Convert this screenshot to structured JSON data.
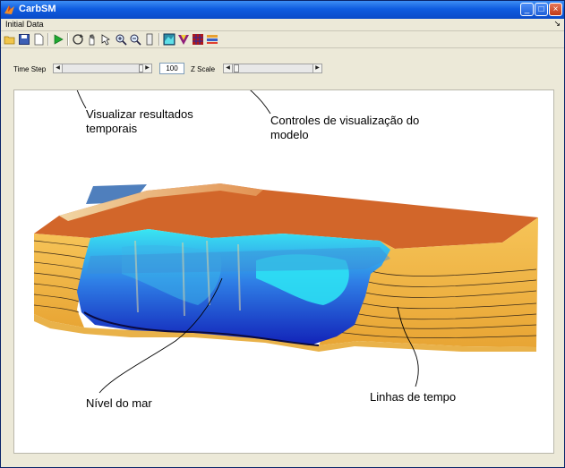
{
  "window": {
    "title": "CarbSM",
    "minimize": "_",
    "maximize": "□",
    "close": "×"
  },
  "menu": {
    "items": [
      "Initial Data"
    ],
    "overflow_arrow": "↘"
  },
  "toolbar": {
    "icons": [
      "open-folder-icon",
      "save-icon",
      "new-document-icon",
      "run-play-icon",
      "rotate-3d-icon",
      "pan-hand-icon",
      "data-cursor-icon",
      "zoom-in-icon",
      "zoom-out-icon",
      "colorbar-icon",
      "surface-view-icon",
      "color-shading-icon",
      "grid-mesh-icon",
      "layers-icon"
    ]
  },
  "controls": {
    "time_step_label": "Time Step",
    "time_step_value": "100",
    "z_scale_label": "Z Scale",
    "left_arrow": "◀",
    "right_arrow": "▶"
  },
  "annotations": {
    "visualizar_line1": "Visualizar resultados",
    "visualizar_line2": "temporais",
    "controles_line1": "Controles de visualização do",
    "controles_line2": "modelo",
    "nivel_do_mar": "Nível do mar",
    "linhas_de_tempo": "Linhas de tempo"
  },
  "colors": {
    "platform_top": "#d2662a",
    "layer_orange": "#f0b040",
    "sea_blue": "#1a33c8",
    "sea_cyan": "#2fe6f0",
    "title_blue": "#0a4bc8"
  }
}
